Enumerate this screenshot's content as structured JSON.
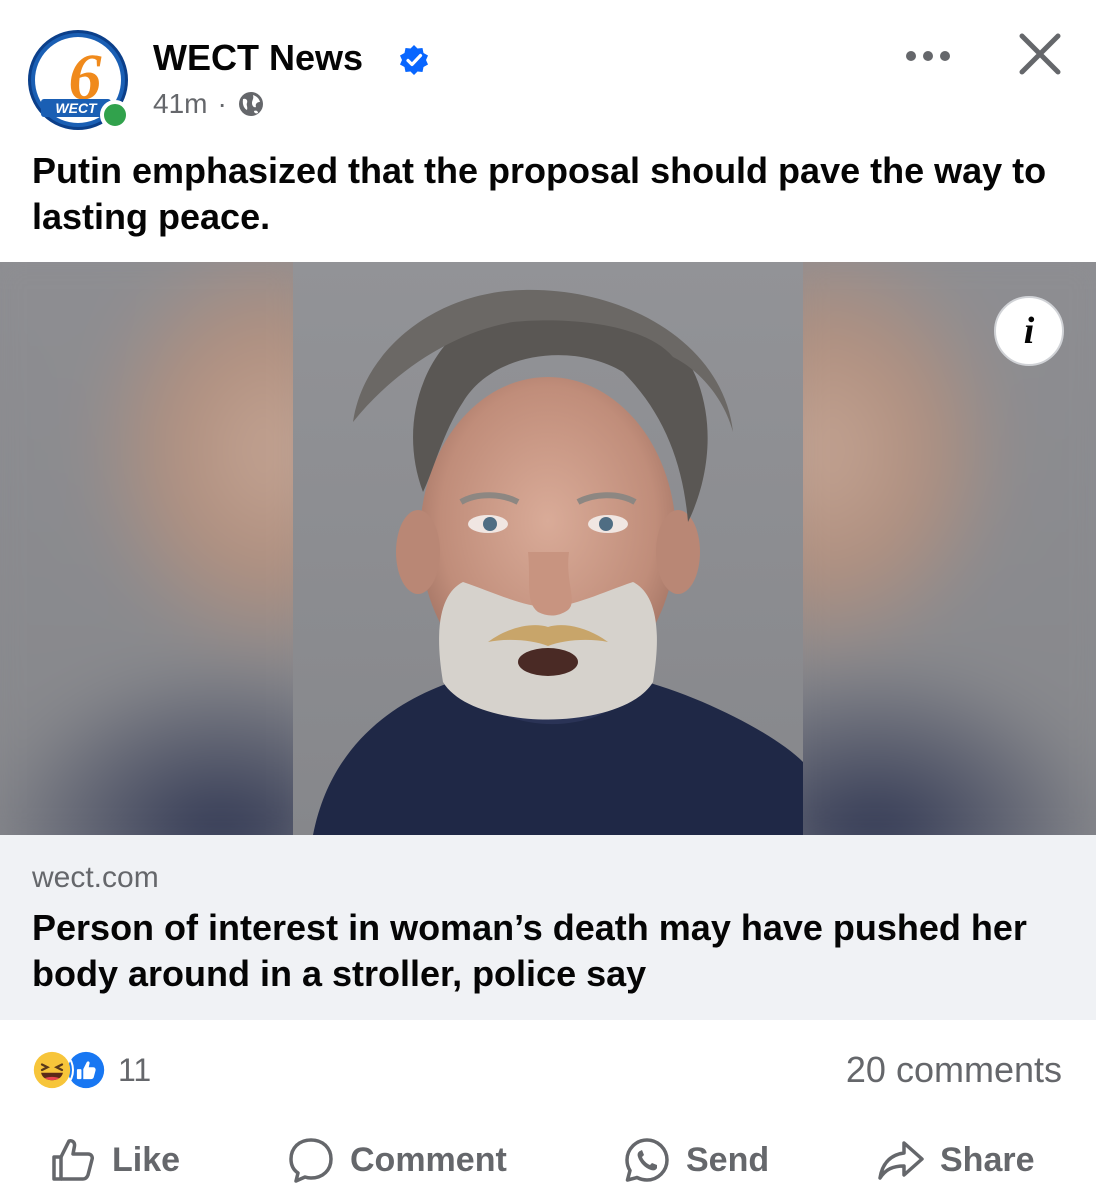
{
  "post": {
    "page_name": "WECT News",
    "time": "41m",
    "separator": "·",
    "avatar_number": "6",
    "avatar_word": "WECT",
    "text": "Putin emphasized that the proposal should pave the way to lasting peace."
  },
  "header": {
    "more_icon": "more-horizontal-icon",
    "close_icon": "close-icon",
    "verified_icon": "verified-badge-icon",
    "audience_icon": "globe-icon"
  },
  "link_preview": {
    "domain": "wect.com",
    "title": "Person of interest in woman’s death may have pushed her body around in a stroller, police say",
    "info_label": "i"
  },
  "engagement": {
    "reaction_count": "11",
    "comments": "20 comments"
  },
  "actions": {
    "like": "Like",
    "comment": "Comment",
    "send": "Send",
    "share": "Share"
  },
  "colors": {
    "text_primary": "#050505",
    "text_secondary": "#65676b",
    "brand_blue": "#1a5fb4",
    "verified_blue": "#0866ff",
    "online_green": "#31a24c",
    "link_bg": "#f0f2f5"
  }
}
